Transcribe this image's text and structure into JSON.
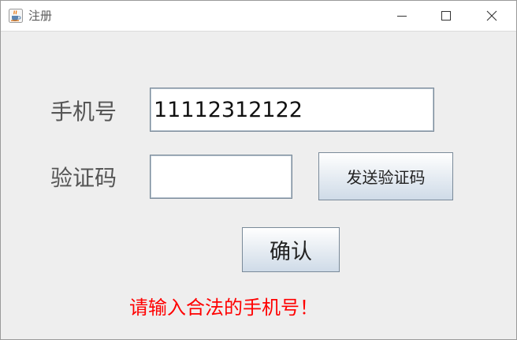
{
  "window": {
    "title": "注册",
    "app_icon": "java-cup-icon",
    "controls": {
      "minimize_icon": "minimize-icon",
      "maximize_icon": "maximize-icon",
      "close_icon": "close-icon"
    }
  },
  "form": {
    "phone_label": "手机号",
    "phone_value": "11112312122",
    "code_label": "验证码",
    "code_value": "",
    "send_code_label": "发送验证码",
    "confirm_label": "确认"
  },
  "status": {
    "error_message": "请输入合法的手机号！",
    "error_color": "#ff0000"
  }
}
